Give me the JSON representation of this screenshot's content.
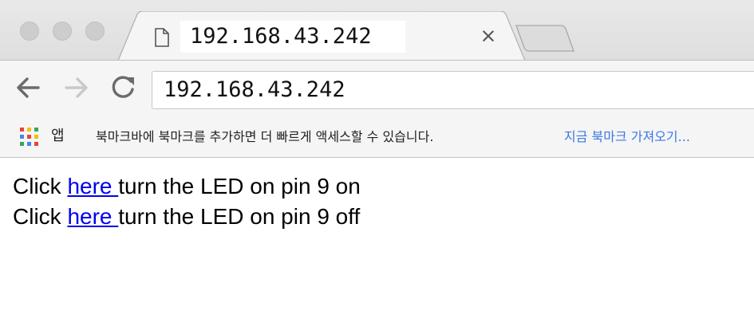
{
  "tab": {
    "title": "192.168.43.242",
    "close": "×",
    "favicon": "page-icon"
  },
  "toolbar": {
    "back_icon": "back-arrow-icon",
    "forward_icon": "forward-arrow-icon",
    "reload_icon": "reload-icon",
    "address": "192.168.43.242"
  },
  "bookmarks": {
    "apps_label": "앱",
    "hint": "북마크바에 북마크를 추가하면 더 빠르게 액세스할 수 있습니다.",
    "import_link": "지금 북마크 가져오기..."
  },
  "page": {
    "lines": [
      {
        "before": "Click ",
        "link": "here ",
        "after": "turn the LED on pin 9 on"
      },
      {
        "before": "Click ",
        "link": "here ",
        "after": "turn the LED on pin 9 off"
      }
    ]
  },
  "colors": {
    "link": "#0000ee",
    "bookmark_link": "#3b78e7",
    "chrome_bg": "#f5f5f5"
  }
}
